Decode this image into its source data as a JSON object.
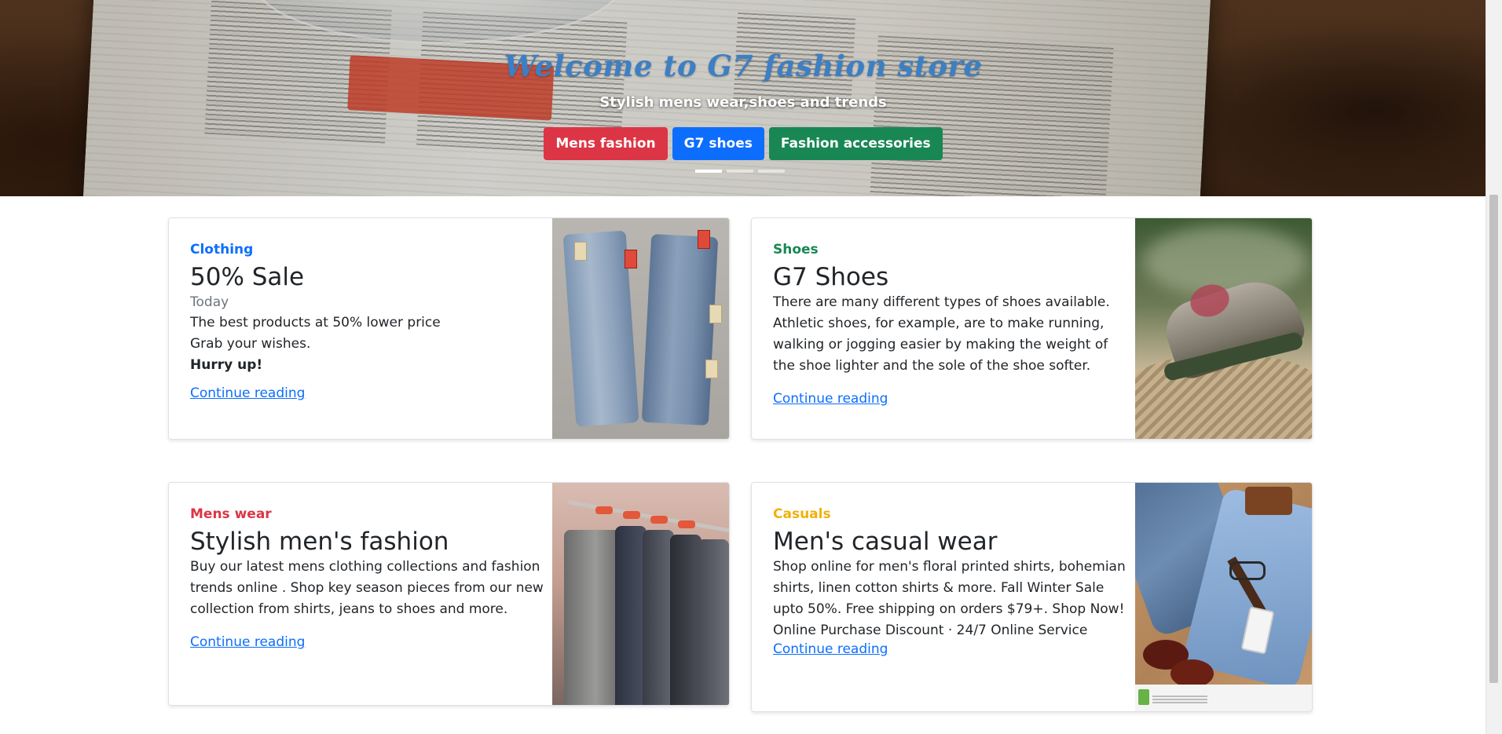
{
  "hero": {
    "title": "Welcome to G7 fashion store",
    "subtitle": "Stylish mens wear,shoes and trends",
    "buttons": [
      {
        "label": "Mens fashion",
        "color": "#dc3545"
      },
      {
        "label": "G7 shoes",
        "color": "#0d6efd"
      },
      {
        "label": "Fashion accessories",
        "color": "#198754"
      }
    ],
    "carousel_slides": 3,
    "active_slide": 1
  },
  "cards": [
    {
      "category": "Clothing",
      "category_color": "#0d6efd",
      "title": "50% Sale",
      "date": "Today",
      "lines": [
        "The best products at 50% lower price",
        "Grab your wishes."
      ],
      "emphasis": "Hurry up!",
      "link": "Continue reading",
      "image": "jeans-photo"
    },
    {
      "category": "Shoes",
      "category_color": "#198754",
      "title": "G7 Shoes",
      "text": "There are many different types of shoes available. Athletic shoes, for example, are to make running, walking or jogging easier by making the weight of the shoe lighter and the sole of the shoe softer.",
      "link": "Continue reading",
      "image": "hiking-shoe-photo"
    },
    {
      "category": "Mens wear",
      "category_color": "#dc3545",
      "title": "Stylish men's fashion",
      "text": "Buy our latest mens clothing collections and fashion trends online . Shop key season pieces from our new collection from shirts, jeans to shoes and more.",
      "link": "Continue reading",
      "image": "clothing-rack-photo"
    },
    {
      "category": "Casuals",
      "category_color": "#f0b10a",
      "title": "Men's casual wear",
      "text": "Shop online for men's floral printed shirts, bohemian shirts, linen cotton shirts & more. Fall Winter Sale upto 50%. Free shipping on orders $79+. Shop Now!",
      "text2": "Online Purchase Discount · 24/7 Online Service",
      "link": "Continue reading",
      "image": "casual-flatlay-photo"
    }
  ]
}
